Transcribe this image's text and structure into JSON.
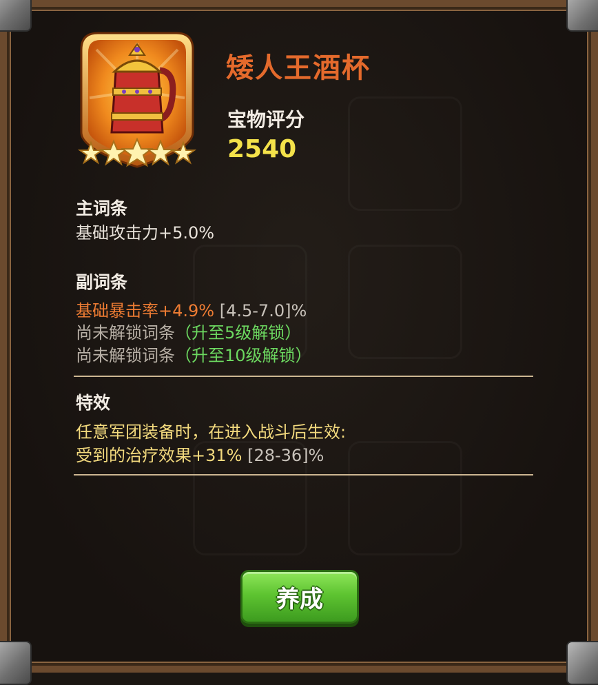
{
  "item": {
    "name": "矮人王酒杯",
    "stars": 5,
    "icon": "dwarf-king-tankard-icon"
  },
  "score": {
    "label": "宝物评分",
    "value": "2540"
  },
  "main_stat": {
    "title": "主词条",
    "text": "基础攻击力+5.0%"
  },
  "sub_stats": {
    "title": "副词条",
    "line1": {
      "stat": "基础暴击率+4.9%",
      "range": "[4.5-7.0]%"
    },
    "line2": {
      "locked": "尚未解锁词条",
      "unlock": "（升至5级解锁）"
    },
    "line3": {
      "locked": "尚未解锁词条",
      "unlock": "（升至10级解锁）"
    }
  },
  "special": {
    "title": "特效",
    "line1": "任意军团装备时，在进入战斗后生效:",
    "line2": {
      "effect": "受到的治疗效果+31%",
      "range": "[28-36]%"
    }
  },
  "button": {
    "label": "养成"
  },
  "colors": {
    "name": "#e46a2c",
    "score": "#f4e24a",
    "sub_stat": "#ee7c33",
    "unlock": "#6cd860",
    "effect": "#f3da7e",
    "button": "#5ec431"
  }
}
